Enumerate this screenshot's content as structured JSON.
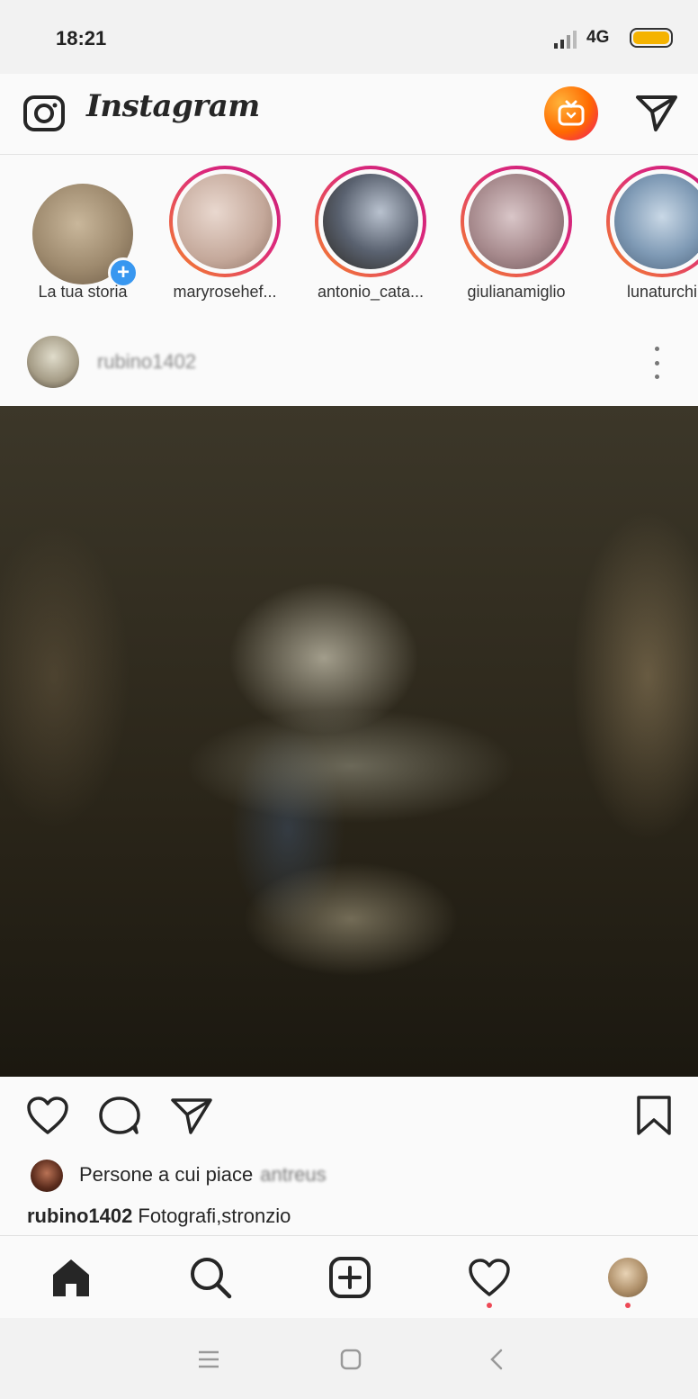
{
  "status_bar": {
    "time": "18:21",
    "network": "4G",
    "signal_icon": "signal-bars-icon",
    "battery_icon": "battery-icon",
    "battery_color": "#f5b300"
  },
  "header": {
    "logo_text": "Instagram",
    "camera_icon": "camera-icon",
    "igtv_icon": "igtv-icon",
    "direct_icon": "paper-plane-icon",
    "igtv_gradient": [
      "#ffb33a",
      "#ff6a00",
      "#f0136b"
    ]
  },
  "stories": {
    "own": {
      "label": "La tua storia",
      "add_icon": "plus-icon",
      "badge_color": "#3897f0"
    },
    "items": [
      {
        "label": "maryrosehef..."
      },
      {
        "label": "antonio_cata..."
      },
      {
        "label": "giulianamiglio"
      },
      {
        "label": "lunaturchi"
      }
    ],
    "ring_gradient": [
      "#f58529",
      "#dd2a7b"
    ]
  },
  "post": {
    "username": "rubino1402",
    "more_icon": "more-vertical-icon",
    "actions": {
      "like_icon": "heart-icon",
      "comment_icon": "comment-icon",
      "share_icon": "paper-plane-icon",
      "save_icon": "bookmark-icon"
    },
    "likes": {
      "prefix": "Persone a cui piace",
      "liker": "antreus"
    },
    "caption": {
      "username": "rubino1402",
      "text": "Fotografi,stronzio"
    }
  },
  "tab_bar": {
    "items": [
      "home-icon",
      "search-icon",
      "add-post-icon",
      "activity-heart-icon",
      "profile-avatar"
    ],
    "notification_dot_color": "#ed4956"
  },
  "system_nav": {
    "items": [
      "menu-icon",
      "home-square-icon",
      "back-chevron-icon"
    ]
  }
}
